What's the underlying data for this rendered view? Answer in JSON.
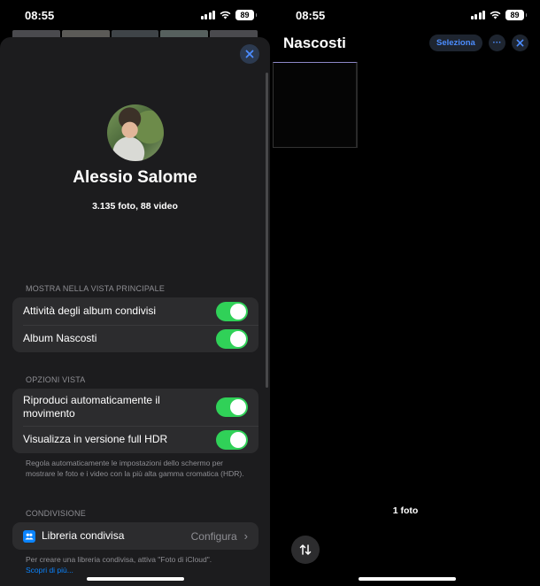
{
  "left": {
    "status": {
      "time": "08:55",
      "battery": "89"
    },
    "profile": {
      "name": "Alessio Salome",
      "counts": "3.135 foto, 88 video"
    },
    "main_view": {
      "header": "MOSTRA NELLA VISTA PRINCIPALE",
      "rows": [
        {
          "label": "Attività degli album condivisi",
          "on": true
        },
        {
          "label": "Album Nascosti",
          "on": true
        }
      ]
    },
    "view_options": {
      "header": "OPZIONI VISTA",
      "rows": [
        {
          "label": "Riproduci automaticamente il movimento",
          "on": true
        },
        {
          "label": "Visualizza in versione full HDR",
          "on": true
        }
      ],
      "footnote": "Regola automaticamente le impostazioni dello schermo per mostrare le foto e i video con la più alta gamma cromatica (HDR)."
    },
    "sharing": {
      "header": "CONDIVISIONE",
      "row": {
        "label": "Libreria condivisa",
        "value": "Configura"
      },
      "footnote": "Per creare una libreria condivisa, attiva \"Foto di iCloud\".",
      "link": "Scopri di più..."
    }
  },
  "right": {
    "status": {
      "time": "08:55",
      "battery": "89"
    },
    "title": "Nascosti",
    "select_label": "Seleziona",
    "more_label": "···",
    "photo_count": "1 foto"
  },
  "colors": {
    "toggle_on": "#30d158",
    "accent": "#0a84ff",
    "sheet_bg": "#1c1c1e",
    "group_bg": "#2c2c2e"
  }
}
